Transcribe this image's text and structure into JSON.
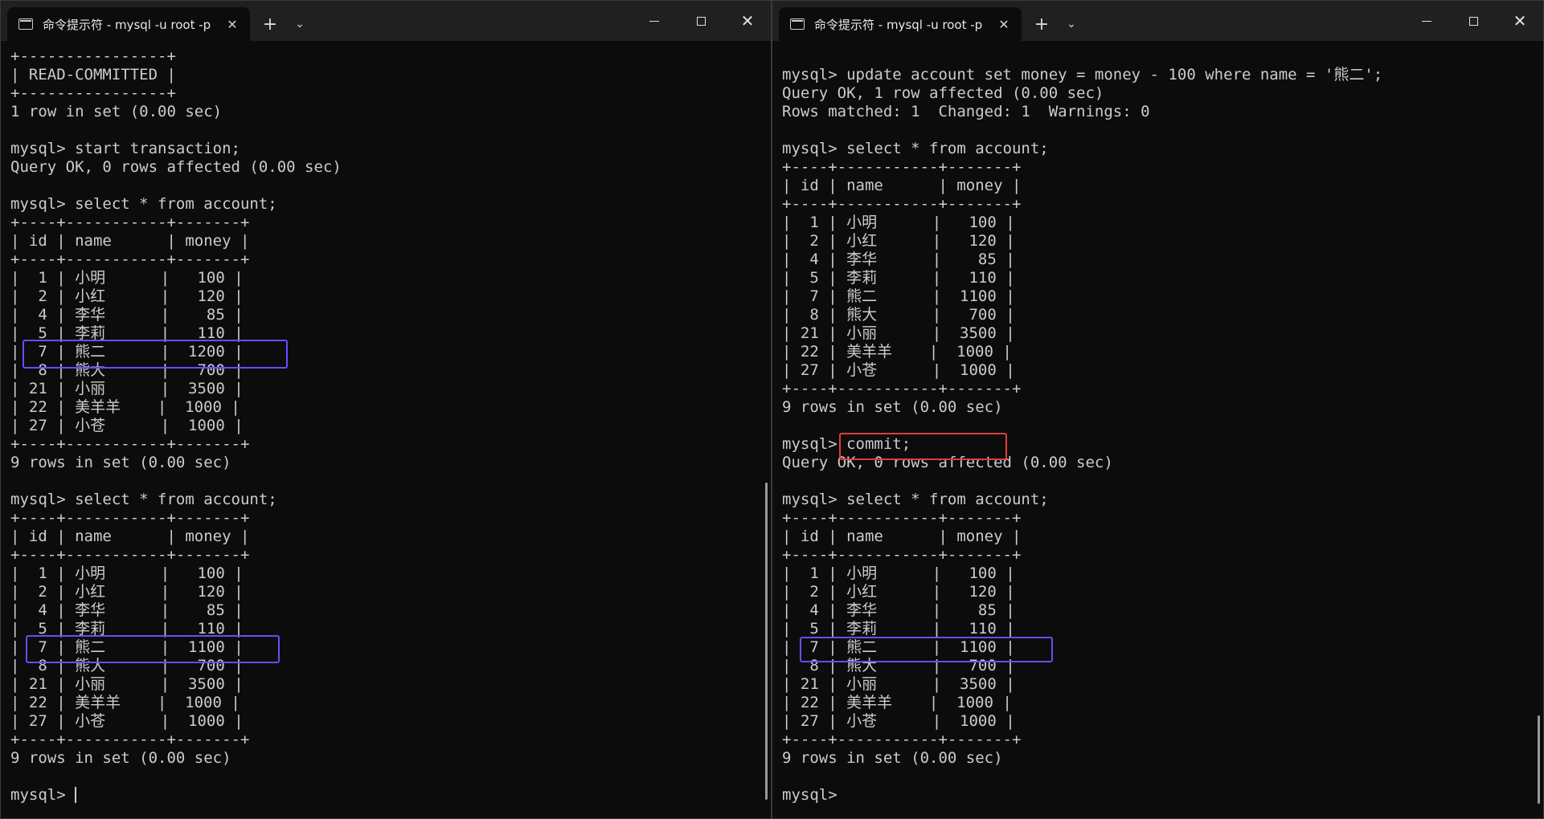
{
  "colors": {
    "terminal_bg": "#0c0c0c",
    "titlebar_bg": "#202020",
    "text": "#cccccc",
    "highlight_purple": "#6a4cff",
    "highlight_red": "#e23b3b"
  },
  "icons": {
    "tab": "terminal-icon",
    "close_tab": "close-icon",
    "new_tab": "plus-icon",
    "dropdown": "chevron-down-icon",
    "minimize": "minimize-icon",
    "maximize": "maximize-icon",
    "close_window": "close-icon"
  },
  "left_window": {
    "tab_title": "命令提示符 - mysql  -u root -p",
    "new_tab_label": "+",
    "dropdown_label": "⌄",
    "lines": [
      "+----------------+",
      "| READ-COMMITTED |",
      "+----------------+",
      "1 row in set (0.00 sec)",
      "",
      "mysql> start transaction;",
      "Query OK, 0 rows affected (0.00 sec)",
      "",
      "mysql> select * from account;",
      "+----+-----------+-------+",
      "| id | name      | money |",
      "+----+-----------+-------+",
      "|  1 | 小明      |   100 |",
      "|  2 | 小红      |   120 |",
      "|  4 | 李华      |    85 |",
      "|  5 | 李莉      |   110 |",
      "|  7 | 熊二      |  1200 |",
      "|  8 | 熊大      |   700 |",
      "| 21 | 小丽      |  3500 |",
      "| 22 | 美羊羊    |  1000 |",
      "| 27 | 小苍      |  1000 |",
      "+----+-----------+-------+",
      "9 rows in set (0.00 sec)",
      "",
      "mysql> select * from account;",
      "+----+-----------+-------+",
      "| id | name      | money |",
      "+----+-----------+-------+",
      "|  1 | 小明      |   100 |",
      "|  2 | 小红      |   120 |",
      "|  4 | 李华      |    85 |",
      "|  5 | 李莉      |   110 |",
      "|  7 | 熊二      |  1100 |",
      "|  8 | 熊大      |   700 |",
      "| 21 | 小丽      |  3500 |",
      "| 22 | 美羊羊    |  1000 |",
      "| 27 | 小苍      |  1000 |",
      "+----+-----------+-------+",
      "9 rows in set (0.00 sec)",
      "",
      "mysql> "
    ]
  },
  "right_window": {
    "tab_title": "命令提示符 - mysql  -u root -p",
    "new_tab_label": "+",
    "dropdown_label": "⌄",
    "lines": [
      "",
      "mysql> update account set money = money - 100 where name = '熊二';",
      "Query OK, 1 row affected (0.00 sec)",
      "Rows matched: 1  Changed: 1  Warnings: 0",
      "",
      "mysql> select * from account;",
      "+----+-----------+-------+",
      "| id | name      | money |",
      "+----+-----------+-------+",
      "|  1 | 小明      |   100 |",
      "|  2 | 小红      |   120 |",
      "|  4 | 李华      |    85 |",
      "|  5 | 李莉      |   110 |",
      "|  7 | 熊二      |  1100 |",
      "|  8 | 熊大      |   700 |",
      "| 21 | 小丽      |  3500 |",
      "| 22 | 美羊羊    |  1000 |",
      "| 27 | 小苍      |  1000 |",
      "+----+-----------+-------+",
      "9 rows in set (0.00 sec)",
      "",
      "mysql> commit;",
      "Query OK, 0 rows affected (0.00 sec)",
      "",
      "mysql> select * from account;",
      "+----+-----------+-------+",
      "| id | name      | money |",
      "+----+-----------+-------+",
      "|  1 | 小明      |   100 |",
      "|  2 | 小红      |   120 |",
      "|  4 | 李华      |    85 |",
      "|  5 | 李莉      |   110 |",
      "|  7 | 熊二      |  1100 |",
      "|  8 | 熊大      |   700 |",
      "| 21 | 小丽      |  3500 |",
      "| 22 | 美羊羊    |  1000 |",
      "| 27 | 小苍      |  1000 |",
      "+----+-----------+-------+",
      "9 rows in set (0.00 sec)",
      "",
      "mysql> "
    ]
  }
}
